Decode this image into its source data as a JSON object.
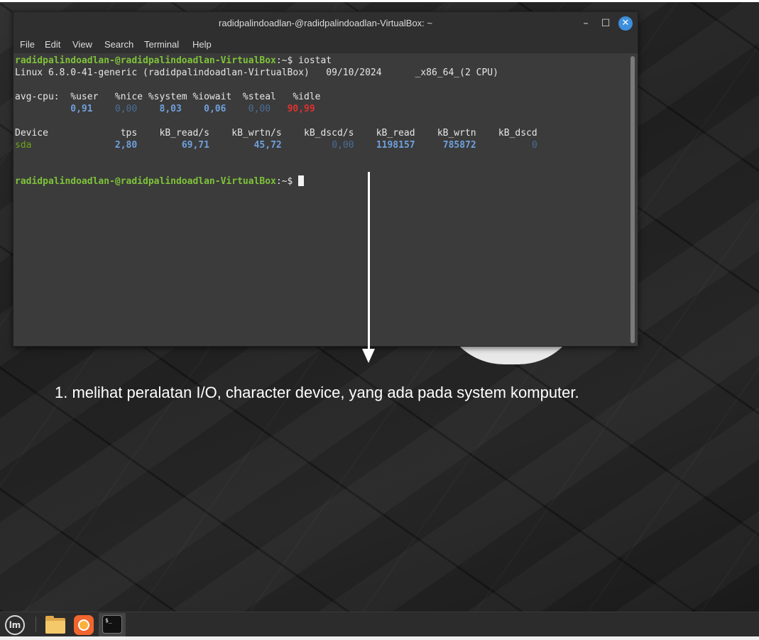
{
  "window": {
    "title": "radidpalindoadlan-@radidpalindoadlan-VirtualBox: ~",
    "minimize_glyph": "–",
    "maximize_glyph": "☐",
    "close_glyph": "✕"
  },
  "menu": [
    "File",
    "Edit",
    "View",
    "Search",
    "Terminal",
    "Help"
  ],
  "terminal": {
    "prompt": "radidpalindoadlan-@radidpalindoadlan-VirtualBox",
    "prompt_suffix": ":~$",
    "command": " iostat",
    "sysinfo": "Linux 6.8.0-41-generic (radidpalindoadlan-VirtualBox)   09/10/2024      _x86_64_(2 CPU)",
    "cpu_header": "avg-cpu:  %user   %nice %system %iowait  %steal   %idle",
    "cpu_values": {
      "user": "0,91",
      "nice": "0,00",
      "system": "8,03",
      "iowait": "0,06",
      "steal": "0,00",
      "idle": "90,99"
    },
    "device_header": "Device             tps    kB_read/s    kB_wrtn/s    kB_dscd/s    kB_read    kB_wrtn    kB_dscd",
    "device_row": {
      "device": "sda",
      "tps": "2,80",
      "kb_read_s": "69,71",
      "kb_wrtn_s": "45,72",
      "kb_dscd_s": "0,00",
      "kb_read": "1198157",
      "kb_wrtn": "785872",
      "kb_dscd": "0"
    }
  },
  "annotation": "1. melihat peralatan I/O, character device, yang ada pada system komputer.",
  "taskbar": {
    "menu_icon_glyph": "lm",
    "terminal_icon_glyph": "$_"
  },
  "colors": {
    "prompt": "#7ec33a",
    "value_blue": "#6fa0dc",
    "value_dim": "#4a6d98",
    "idle_red": "#e03030",
    "device_green": "#6fa31c",
    "close_button": "#3e8fdd"
  }
}
